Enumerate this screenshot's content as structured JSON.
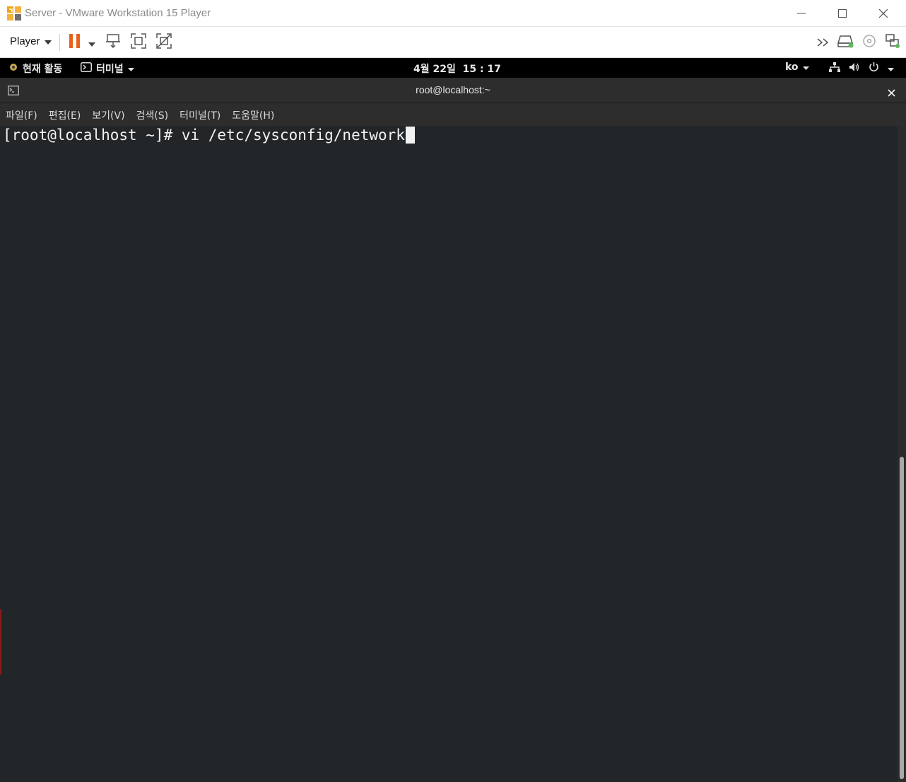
{
  "window": {
    "title": "Server - VMware Workstation 15 Player",
    "icons": [
      "vmware-logo-icon",
      "minimize-icon",
      "maximize-icon",
      "close-icon"
    ]
  },
  "toolbar": {
    "player_label": "Player",
    "left_icons": [
      "pause-icon",
      "dropdown-arrow-icon",
      "send-ctrl-alt-del-icon",
      "fullscreen-icon",
      "unity-icon"
    ],
    "right_icons": [
      "more-devices-icon",
      "hard-disk-icon",
      "cd-dvd-icon",
      "network-adapter-icon"
    ],
    "accent_color": "#e8611a",
    "status_green": "#5cb85c"
  },
  "gnome": {
    "activities": "현재 활동",
    "app_menu": "터미널",
    "clock": "4월 22일  15 : 17",
    "input_method": "ko"
  },
  "terminal": {
    "title": "root@localhost:~",
    "menu": [
      "파일(F)",
      "편집(E)",
      "보기(V)",
      "검색(S)",
      "터미널(T)",
      "도움말(H)"
    ],
    "prompt_line": "[root@localhost ~]# vi /etc/sysconfig/network"
  }
}
